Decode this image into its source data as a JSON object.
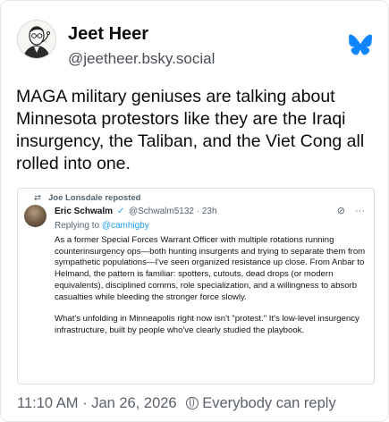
{
  "post": {
    "author_name": "Jeet Heer",
    "author_handle": "@jeetheer.bsky.social",
    "text": "MAGA military geniuses are talking about Minnesota protestors like they are the Iraqi insurgency, the Taliban, and the Viet Cong all rolled into one.",
    "icons": {
      "avatar": "cartoon-portrait-avatar",
      "platform": "bluesky-butterfly-icon"
    }
  },
  "embed": {
    "repost_label": "Joe Lonsdale reposted",
    "author_name": "Eric Schwalm",
    "verified_mark": "✓",
    "author_handle": "@Schwalm5132",
    "separator": "·",
    "time": "23h",
    "replying_label": "Replying to",
    "replying_to": "@camhigby",
    "body_1": "As a former Special Forces Warrant Officer with multiple rotations running counterinsurgency ops—both hunting insurgents and trying to separate them from sympathetic populations—I've seen organized resistance up close. From Anbar to Helmand, the pattern is familiar: spotters, cutouts, dead drops (or modern equivalents), disciplined comms, role specialization, and a willingness to absorb casualties while bleeding the stronger force slowly.",
    "body_2": "What's unfolding in Minneapolis right now isn't \"protest.\" It's low-level insurgency infrastructure, built by people who've clearly studied the playbook.",
    "icons": {
      "repost": "repost-icon",
      "grok": "grok-icon",
      "more": "more-options-icon"
    }
  },
  "footer": {
    "time": "11:10 AM",
    "separator": "·",
    "date": "Jan 26, 2026",
    "reply_setting": "Everybody can reply",
    "icon": "globe-icon"
  },
  "colors": {
    "bluesky_blue": "#1185fe",
    "link_blue": "#1d9bf0",
    "muted_gray": "#5b6168"
  }
}
